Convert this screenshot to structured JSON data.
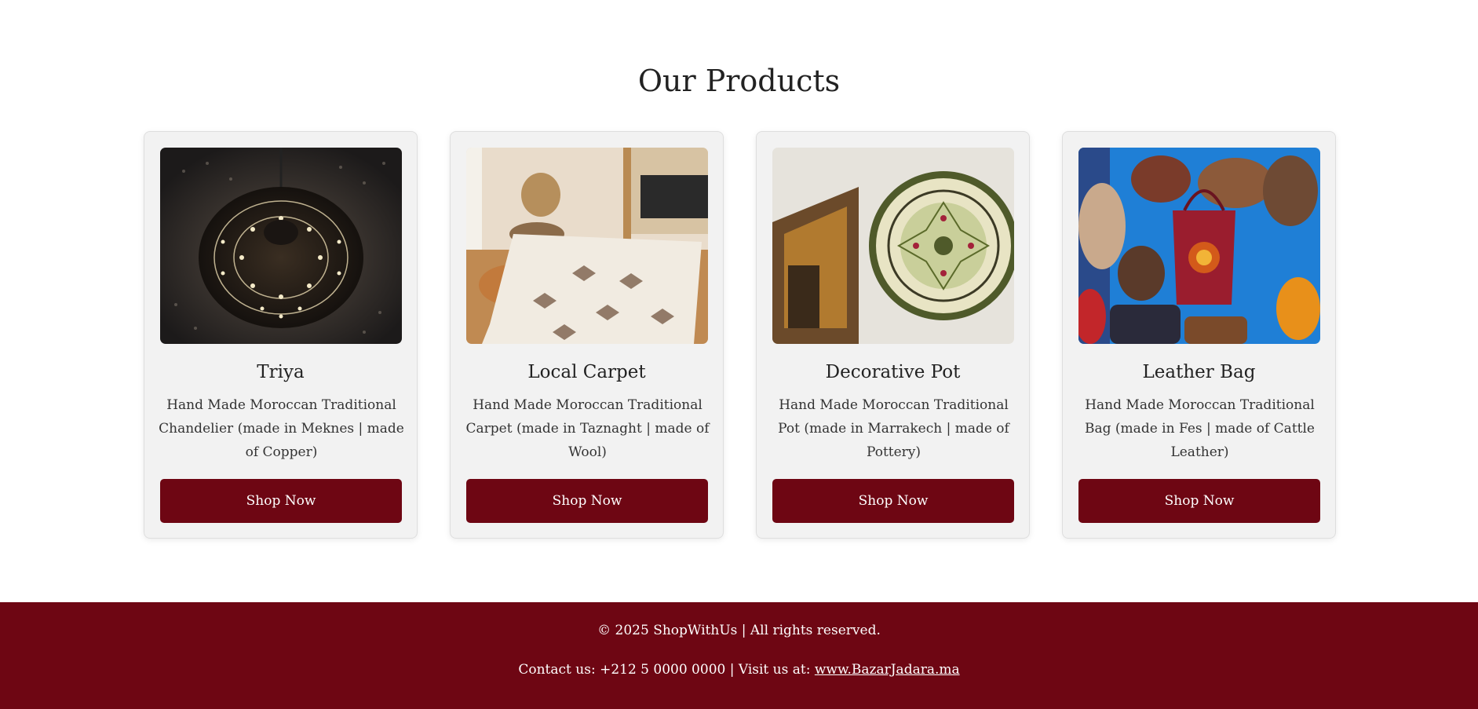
{
  "section": {
    "title": "Our Products"
  },
  "products": [
    {
      "name": "Triya",
      "description": "Hand Made Moroccan Traditional Chandelier (made in Meknes | made of Copper)",
      "button_label": "Shop Now",
      "image_alt": "Moroccan copper chandelier"
    },
    {
      "name": "Local Carpet",
      "description": "Hand Made Moroccan Traditional Carpet (made in Taznaght | made of Wool)",
      "button_label": "Shop Now",
      "image_alt": "Moroccan wool carpet"
    },
    {
      "name": "Decorative Pot",
      "description": "Hand Made Moroccan Traditional Pot (made in Marrakech | made of Pottery)",
      "button_label": "Shop Now",
      "image_alt": "Moroccan decorative plate"
    },
    {
      "name": "Leather Bag",
      "description": "Hand Made Moroccan Traditional Bag (made in Fes | made of Cattle Leather)",
      "button_label": "Shop Now",
      "image_alt": "Moroccan leather bags"
    }
  ],
  "footer": {
    "copyright": "© 2025 ShopWithUs | All rights reserved.",
    "contact_prefix": "Contact us: +212 5 0000 0000 | Visit us at: ",
    "link_text": "www.BazarJadara.ma"
  },
  "colors": {
    "brand": "#6e0613",
    "card_bg": "#f2f2f2",
    "page_bg": "#ffffff"
  }
}
